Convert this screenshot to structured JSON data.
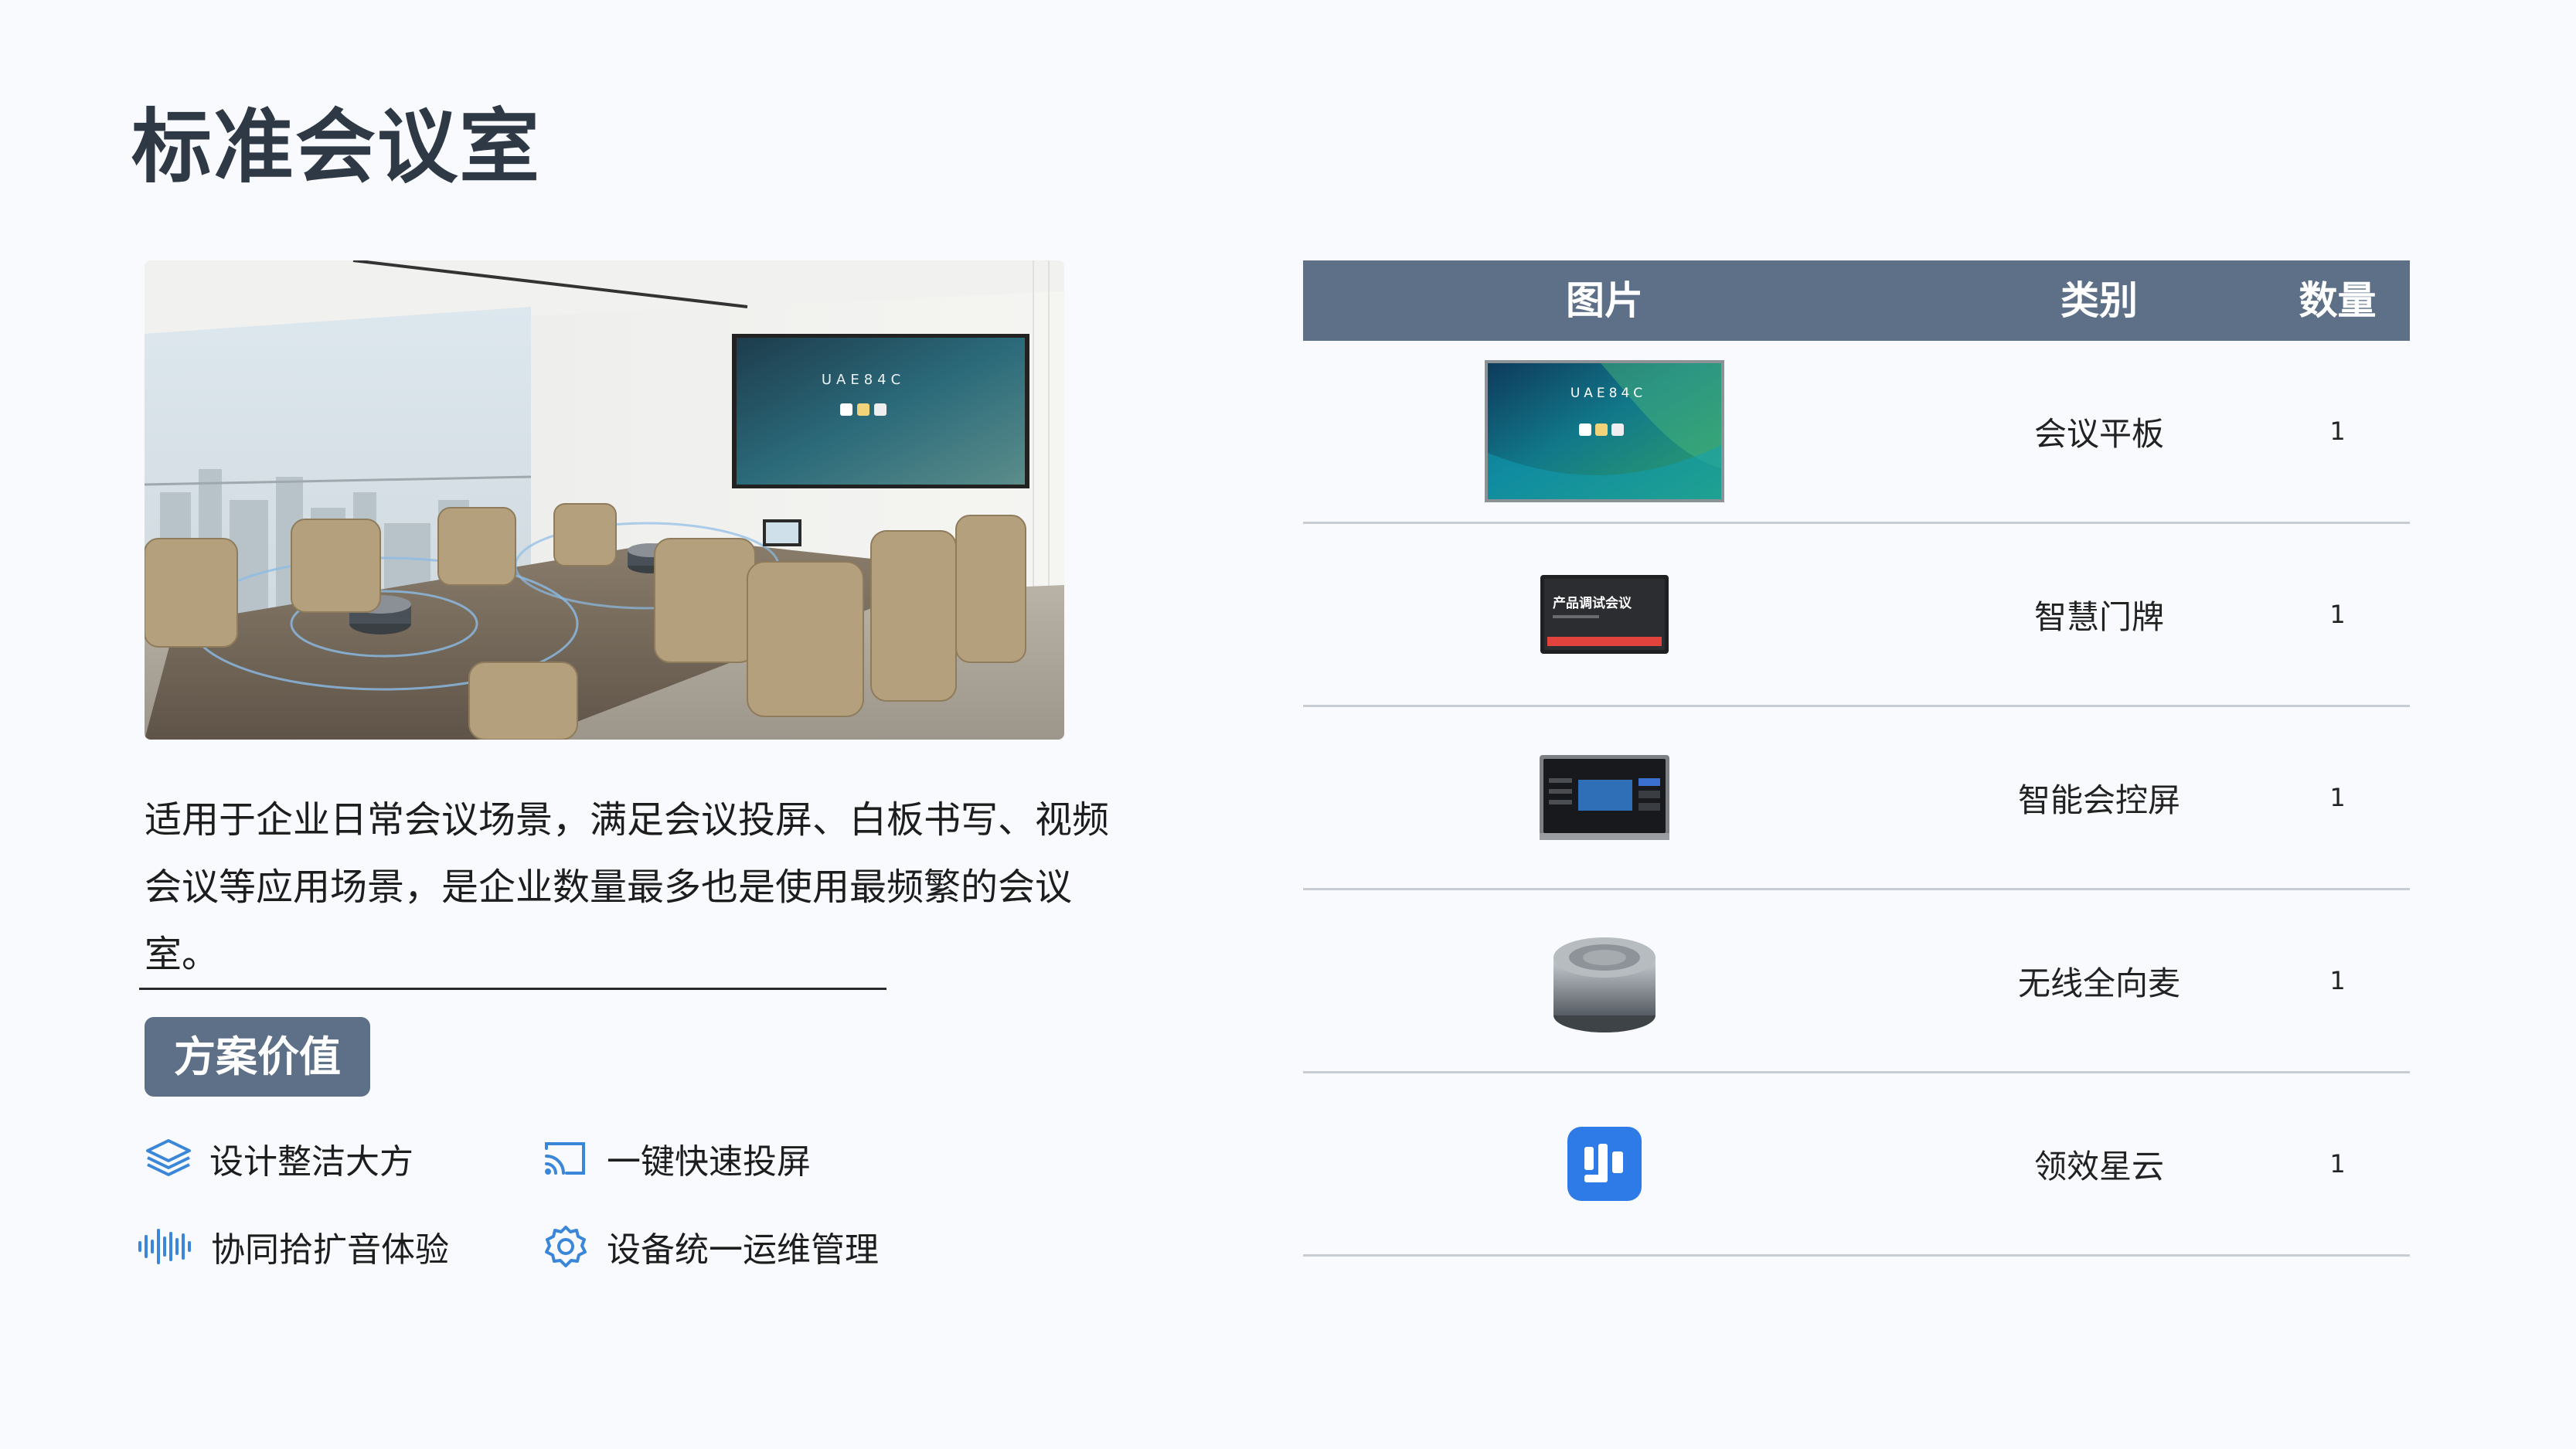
{
  "title": "标准会议室",
  "description": "适用于企业日常会议场景，满足会议投屏、白板书写、视频会议等应用场景，是企业数量最多也是使用最频繁的会议室。",
  "hero": {
    "screen_text": "UAE84C"
  },
  "value_badge": "方案价值",
  "features": [
    {
      "label": "设计整洁大方",
      "icon": "layers-icon"
    },
    {
      "label": "一键快速投屏",
      "icon": "cast-icon"
    },
    {
      "label": "协同拾扩音体验",
      "icon": "sound-wave-icon"
    },
    {
      "label": "设备统一运维管理",
      "icon": "gear-icon"
    }
  ],
  "table": {
    "headers": {
      "image": "图片",
      "category": "类别",
      "quantity": "数量"
    },
    "rows": [
      {
        "category": "会议平板",
        "quantity": "1",
        "image": "meeting-panel",
        "screen_text": "UAE84C"
      },
      {
        "category": "智慧门牌",
        "quantity": "1",
        "image": "door-sign",
        "screen_text": "产品调试会议"
      },
      {
        "category": "智能会控屏",
        "quantity": "1",
        "image": "control-screen"
      },
      {
        "category": "无线全向麦",
        "quantity": "1",
        "image": "omni-mic"
      },
      {
        "category": "领效星云",
        "quantity": "1",
        "image": "app-logo"
      }
    ]
  },
  "colors": {
    "accent": "#5d7087",
    "icon_blue": "#3a86d8",
    "title": "#2f3945",
    "background": "#f8fafd"
  }
}
